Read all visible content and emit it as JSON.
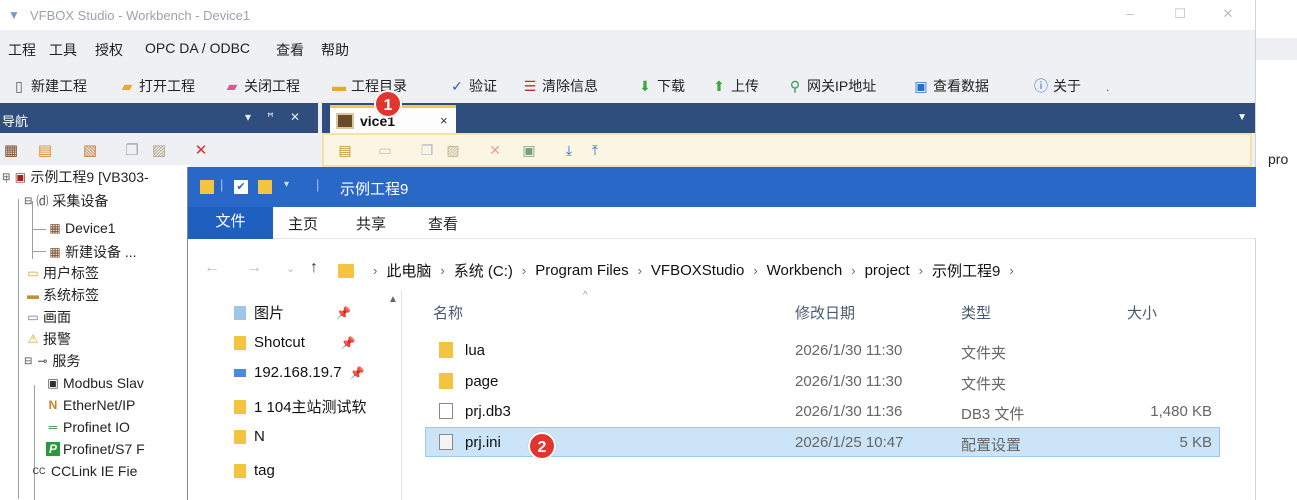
{
  "workbench": {
    "title": "VFBOX Studio - Workbench - Device1",
    "menu": [
      "工程",
      "工具",
      "授权",
      "OPC DA / ODBC",
      "查看",
      "帮助"
    ],
    "toolbar": [
      {
        "label": "新建工程",
        "icon": "new-doc-icon"
      },
      {
        "label": "打开工程",
        "icon": "open-folder-icon"
      },
      {
        "label": "关闭工程",
        "icon": "close-folder-icon"
      },
      {
        "label": "工程目录",
        "icon": "directory-icon"
      },
      {
        "label": "验证",
        "icon": "check-icon"
      },
      {
        "label": "清除信息",
        "icon": "clear-icon"
      },
      {
        "label": "下载",
        "icon": "download-icon"
      },
      {
        "label": "上传",
        "icon": "upload-icon"
      },
      {
        "label": "网关IP地址",
        "icon": "network-icon"
      },
      {
        "label": "查看数据",
        "icon": "monitor-icon"
      },
      {
        "label": "关于",
        "icon": "info-icon"
      }
    ],
    "nav_panel": {
      "title": "导航",
      "tree": [
        {
          "label": "示例工程9 [VB303-",
          "level": 0
        },
        {
          "label": "采集设备",
          "level": 1
        },
        {
          "label": "Device1",
          "level": 2
        },
        {
          "label": "新建设备 ...",
          "level": 2
        },
        {
          "label": "用户标签",
          "level": 1
        },
        {
          "label": "系统标签",
          "level": 1
        },
        {
          "label": "画面",
          "level": 1
        },
        {
          "label": "报警",
          "level": 1
        },
        {
          "label": "服务",
          "level": 1
        },
        {
          "label": "Modbus Slav",
          "level": 2
        },
        {
          "label": "EtherNet/IP",
          "level": 2
        },
        {
          "label": "Profinet IO",
          "level": 2
        },
        {
          "label": "Profinet/S7 F",
          "level": 2
        },
        {
          "label": "CCLink IE Fie",
          "level": 2
        }
      ]
    },
    "doc_tab": {
      "label": "vice1",
      "close": "×"
    },
    "right_strip_text": "pro"
  },
  "explorer": {
    "title": "示例工程9",
    "ribbon_tabs": [
      "文件",
      "主页",
      "共享",
      "查看"
    ],
    "breadcrumbs": [
      "此电脑",
      "系统 (C:)",
      "Program Files",
      "VFBOXStudio",
      "Workbench",
      "project",
      "示例工程9"
    ],
    "quick_access": [
      {
        "label": "图片",
        "pinned": true
      },
      {
        "label": "Shotcut",
        "pinned": true
      },
      {
        "label": "192.168.19.7",
        "pinned": true
      },
      {
        "label": "1 104主站测试软",
        "pinned": false
      },
      {
        "label": "N",
        "pinned": false
      },
      {
        "label": "tag",
        "pinned": false
      }
    ],
    "columns": [
      "名称",
      "修改日期",
      "类型",
      "大小"
    ],
    "files": [
      {
        "name": "lua",
        "modified": "2026/1/30 11:30",
        "type": "文件夹",
        "size": "",
        "icon": "folder-icon"
      },
      {
        "name": "page",
        "modified": "2026/1/30 11:30",
        "type": "文件夹",
        "size": "",
        "icon": "folder-icon"
      },
      {
        "name": "prj.db3",
        "modified": "2026/1/30 11:36",
        "type": "DB3 文件",
        "size": "1,480 KB",
        "icon": "file-icon"
      },
      {
        "name": "prj.ini",
        "modified": "2026/1/25 10:47",
        "type": "配置设置",
        "size": "5 KB",
        "icon": "ini-file-icon",
        "selected": true
      }
    ]
  },
  "annotations": [
    "1",
    "2"
  ],
  "colors": {
    "nav_header": "#2f4e7d",
    "explorer_title": "#2a68c8",
    "selection": "#cce4f7",
    "badge": "#e0362e"
  }
}
